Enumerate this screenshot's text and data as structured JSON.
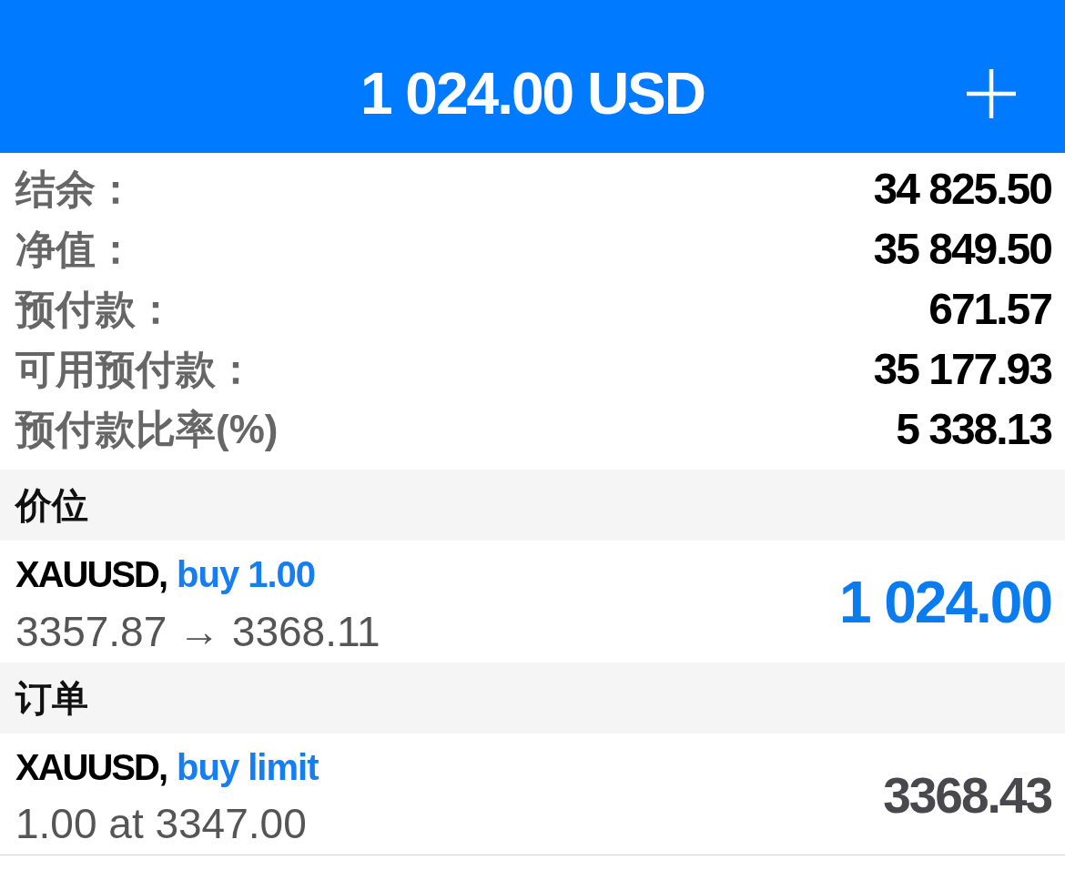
{
  "header": {
    "title": "1 024.00 USD"
  },
  "summary": [
    {
      "label": "结余：",
      "value": "34 825.50"
    },
    {
      "label": "净值：",
      "value": "35 849.50"
    },
    {
      "label": "预付款：",
      "value": "671.57"
    },
    {
      "label": "可用预付款：",
      "value": "35 177.93"
    },
    {
      "label": "预付款比率(%)",
      "value": "5 338.13"
    }
  ],
  "sections": [
    {
      "title": "价位",
      "rows": [
        {
          "kind": "position",
          "symbol": "XAUUSD,",
          "action": "buy 1.00",
          "detail": "3357.87 → 3368.11",
          "value": "1 024.00"
        }
      ]
    },
    {
      "title": "订单",
      "rows": [
        {
          "kind": "order",
          "symbol": "XAUUSD,",
          "action": "buy limit",
          "detail": "1.00 at 3347.00",
          "value": "3368.43"
        }
      ]
    }
  ]
}
